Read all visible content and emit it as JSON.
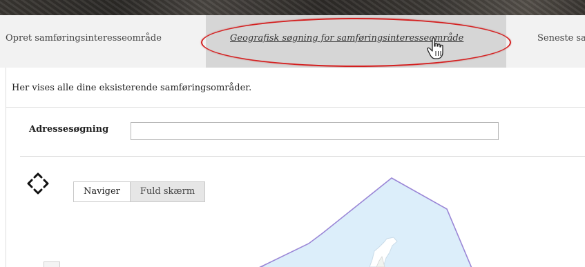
{
  "tabs": [
    {
      "label": "Opret samføringsinteresseområde"
    },
    {
      "label": "Geografisk søgning for samføringsinteresseområde"
    },
    {
      "label": "Seneste sa"
    }
  ],
  "intro_text": "Her vises alle dine eksisterende samføringsområder.",
  "address_search": {
    "label": "Adressesøgning",
    "value": "",
    "placeholder": ""
  },
  "map": {
    "buttons": {
      "navigate": "Naviger",
      "fullscreen": "Fuld skærm"
    },
    "area_fill": "#dceefa",
    "area_stroke": "#9a86d6"
  },
  "colors": {
    "highlight_ellipse": "#d42020",
    "active_tab_bg": "#d6d6d6"
  }
}
